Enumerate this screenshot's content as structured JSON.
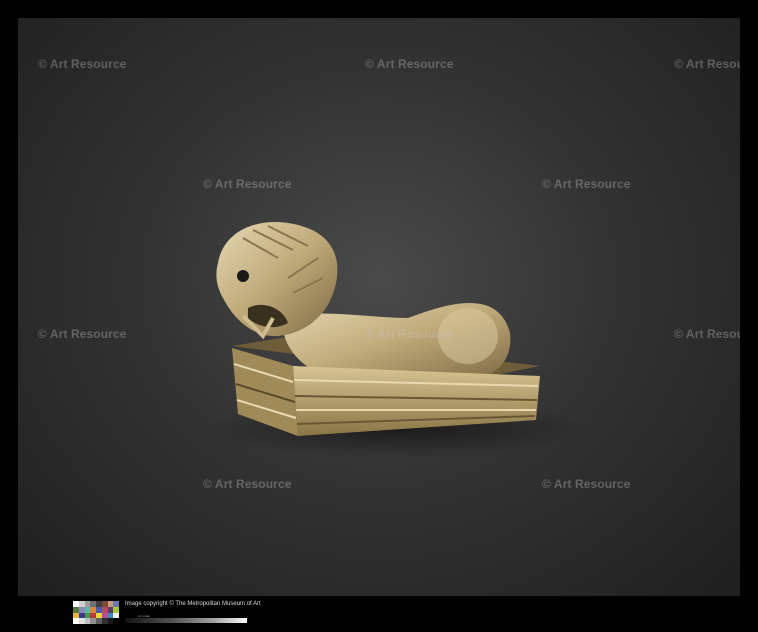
{
  "watermark": {
    "text": "© Art Resource"
  },
  "footer": {
    "copyright": "Image copyright © The Metropolitan Museum of Art",
    "scale_label": "cm scale"
  },
  "colors": {
    "background": "#000000",
    "gold": "#c9b58a"
  },
  "chart_swatches": [
    "#ffffff",
    "#d0d0d0",
    "#a0a0a0",
    "#707070",
    "#404040",
    "#7a4a3a",
    "#c89a7a",
    "#6a7aa8",
    "#5a7a3a",
    "#8a8ab8",
    "#5ab8a8",
    "#d88a3a",
    "#4a5aa8",
    "#b84a5a",
    "#5a3a6a",
    "#a8c83a",
    "#e8b83a",
    "#3a3a8a",
    "#4a9a4a",
    "#b83a3a",
    "#e8d83a",
    "#b84a9a",
    "#3a8ab8",
    "#f0f0f0",
    "#ffffff",
    "#e0e0e0",
    "#c0c0c0",
    "#909090",
    "#606060",
    "#303030",
    "#181818",
    "#000000"
  ]
}
